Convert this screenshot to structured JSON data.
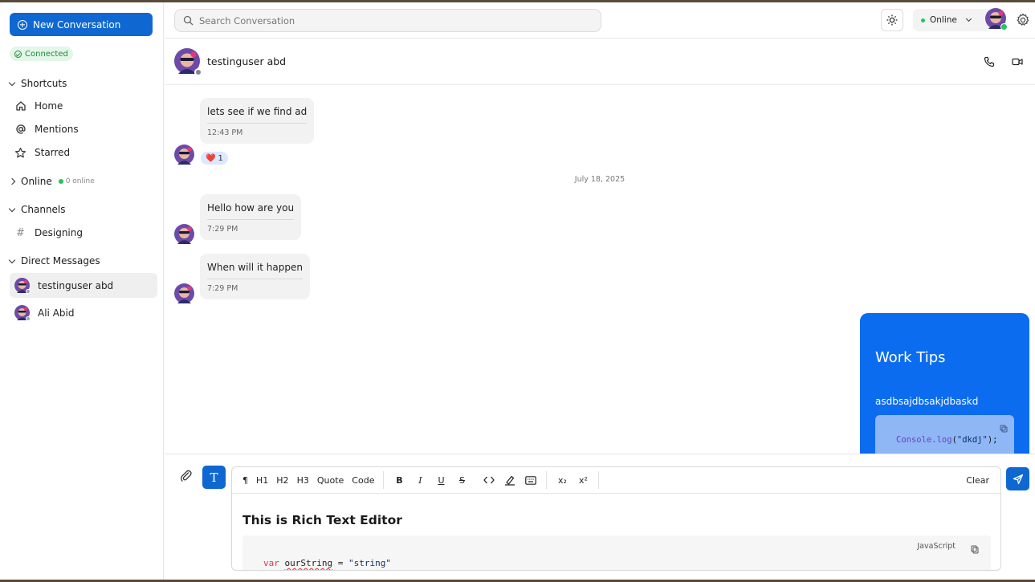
{
  "sidebar": {
    "new_conversation": "New Conversation",
    "connection_status": "Connected",
    "shortcuts": {
      "title": "Shortcuts",
      "items": [
        {
          "label": "Home",
          "icon": "home-icon"
        },
        {
          "label": "Mentions",
          "icon": "at-icon"
        },
        {
          "label": "Starred",
          "icon": "star-icon"
        }
      ]
    },
    "online": {
      "title": "Online",
      "count": "0 online"
    },
    "channels": {
      "title": "Channels",
      "items": [
        {
          "label": "Designing",
          "icon": "hash-icon"
        }
      ]
    },
    "direct_messages": {
      "title": "Direct Messages",
      "items": [
        {
          "label": "testinguser abd",
          "active": true
        },
        {
          "label": "Ali Abid",
          "active": false
        }
      ]
    }
  },
  "topbar": {
    "search_placeholder": "Search Conversation",
    "status": "Online"
  },
  "chat": {
    "contact_name": "testinguser abd",
    "messages": [
      {
        "text": "lets see if we find ad",
        "time": "12:43 PM",
        "reaction": {
          "emoji": "❤️",
          "count": "1"
        }
      },
      {
        "date_separator": "July 18, 2025"
      },
      {
        "text": "Hello how are you",
        "time": "7:29 PM"
      },
      {
        "text": "When will it happen",
        "time": "7:29 PM"
      }
    ],
    "outgoing_card": {
      "title": "Work Tips",
      "text": "asdbsajdbsakjdbaskd",
      "code": {
        "obj": "Console",
        "dot": ".",
        "fn": "log",
        "open": "(",
        "arg": "\"dkdj\"",
        "close": ");"
      }
    }
  },
  "composer": {
    "format_toggle": "T",
    "toolbar": {
      "paragraph": "¶",
      "h1": "H1",
      "h2": "H2",
      "h3": "H3",
      "quote": "Quote",
      "code": "Code",
      "bold": "B",
      "italic": "I",
      "underline": "U",
      "strike": "S",
      "subscript": "x₂",
      "superscript": "x²",
      "clear": "Clear"
    },
    "heading": "This is Rich Text Editor",
    "code_block": {
      "language": "JavaScript",
      "keyword": "var",
      "identifier": "ourString",
      "operator": " = ",
      "value": "\"string\""
    }
  },
  "colors": {
    "accent": "#0f67d1",
    "card": "#0b6cf0",
    "online": "#22c55e",
    "connected_bg": "#e3f6e8"
  }
}
